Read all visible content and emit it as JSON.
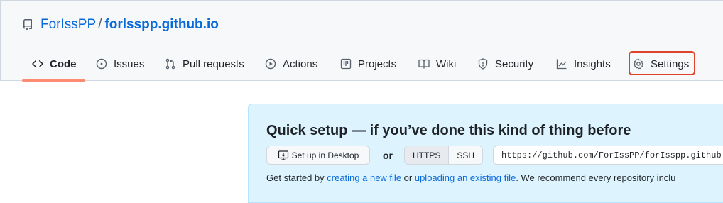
{
  "repo": {
    "owner": "ForIssPP",
    "separator": "/",
    "name": "forlsspp.github.io"
  },
  "tabs": [
    {
      "label": "Code",
      "icon": "code-icon",
      "selected": true
    },
    {
      "label": "Issues",
      "icon": "issue-opened-icon"
    },
    {
      "label": "Pull requests",
      "icon": "git-pull-request-icon"
    },
    {
      "label": "Actions",
      "icon": "play-icon"
    },
    {
      "label": "Projects",
      "icon": "table-icon"
    },
    {
      "label": "Wiki",
      "icon": "book-icon"
    },
    {
      "label": "Security",
      "icon": "shield-icon"
    },
    {
      "label": "Insights",
      "icon": "graph-icon"
    },
    {
      "label": "Settings",
      "icon": "gear-icon",
      "highlighted": true
    }
  ],
  "quick_setup": {
    "title": "Quick setup — if you’ve done this kind of thing before",
    "desktop_button": "Set up in Desktop",
    "or": "or",
    "https_label": "HTTPS",
    "ssh_label": "SSH",
    "selected_protocol": "HTTPS",
    "clone_url": "https://github.com/ForIssPP/forIsspp.github",
    "help_prefix": "Get started by ",
    "help_link1": "creating a new file",
    "help_mid": " or ",
    "help_link2": "uploading an existing file",
    "help_suffix": ". We recommend every repository inclu"
  },
  "colors": {
    "link": "#0969da",
    "tab_underline": "#fd8c73",
    "highlight_border": "#e0432a",
    "setup_background": "#ddf4ff"
  }
}
